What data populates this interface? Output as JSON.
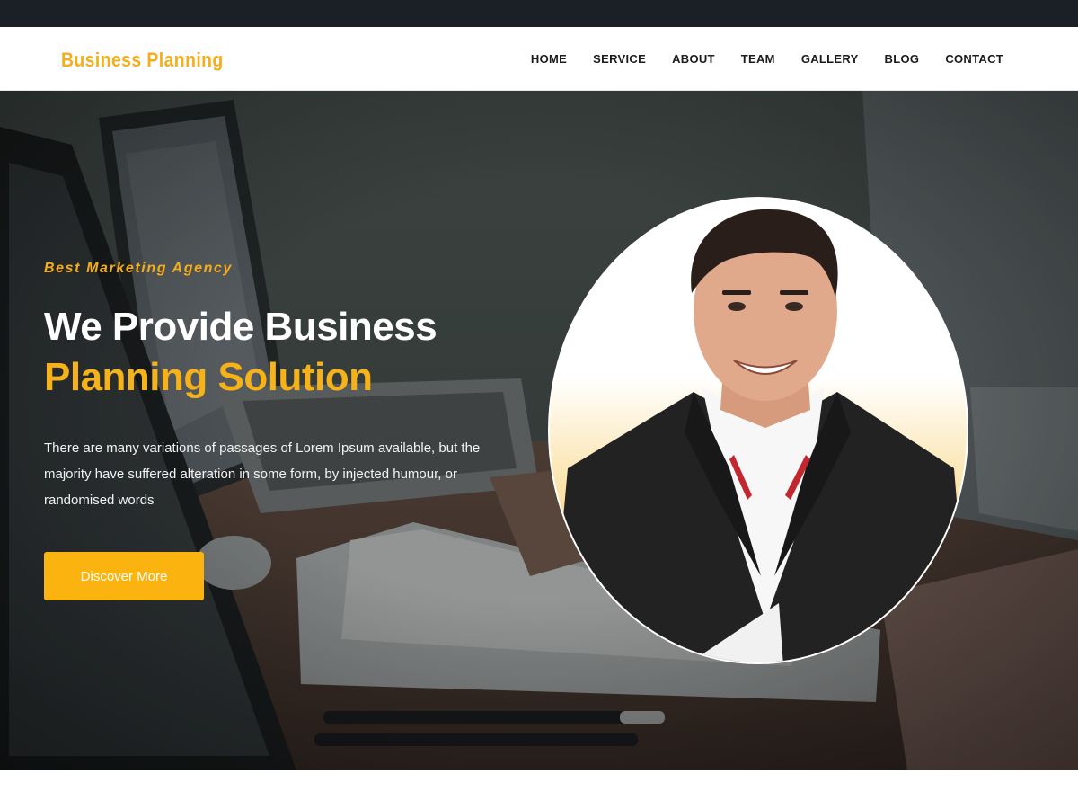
{
  "brand": {
    "name": "Business Planning"
  },
  "nav": {
    "items": [
      {
        "label": "HOME"
      },
      {
        "label": "SERVICE"
      },
      {
        "label": "ABOUT"
      },
      {
        "label": "TEAM"
      },
      {
        "label": "GALLERY"
      },
      {
        "label": "BLOG"
      },
      {
        "label": "CONTACT"
      }
    ]
  },
  "hero": {
    "tagline": "Best Marketing Agency",
    "headline_line1": "We Provide Business",
    "headline_line2": "Planning Solution",
    "description": "There are many variations of passages of Lorem Ipsum available, but the majority have suffered alteration in some form, by injected humour, or randomised words",
    "cta_label": "Discover More"
  },
  "colors": {
    "accent": "#f5ad1b",
    "topbar": "#1b2026",
    "button": "#fbb40f"
  }
}
